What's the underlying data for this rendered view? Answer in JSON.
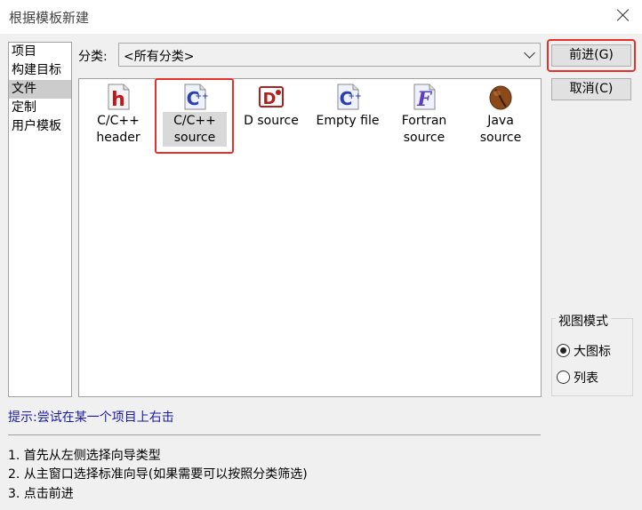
{
  "window": {
    "title": "根据模板新建"
  },
  "left_list": {
    "items": [
      "项目",
      "构建目标",
      "文件",
      "定制",
      "用户模板"
    ],
    "selected_index": 2
  },
  "category": {
    "label": "分类:",
    "value": "<所有分类>"
  },
  "templates": [
    {
      "line1": "C/C++",
      "line2": "header",
      "icon": "cpp-header-icon"
    },
    {
      "line1": "C/C++",
      "line2": "source",
      "icon": "cpp-source-icon"
    },
    {
      "line1": "D source",
      "line2": "",
      "icon": "d-source-icon"
    },
    {
      "line1": "Empty file",
      "line2": "",
      "icon": "empty-file-icon"
    },
    {
      "line1": "Fortran",
      "line2": "source",
      "icon": "fortran-source-icon"
    },
    {
      "line1": "Java",
      "line2": "source",
      "icon": "java-source-icon"
    }
  ],
  "buttons": {
    "next": "前进(G)",
    "cancel": "取消(C)"
  },
  "view_mode": {
    "title": "视图模式",
    "large_icons": "大图标",
    "list": "列表",
    "selected": "large_icons"
  },
  "hint": "提示:尝试在某一个项目上右击",
  "steps": [
    "1. 首先从左侧选择向导类型",
    "2. 从主窗口选择标准向导(如果需要可以按照分类筛选)",
    "3. 点击前进"
  ],
  "colors": {
    "highlight": "#e8302a",
    "hint": "#1a1aa8",
    "selection": "#cccccc"
  }
}
